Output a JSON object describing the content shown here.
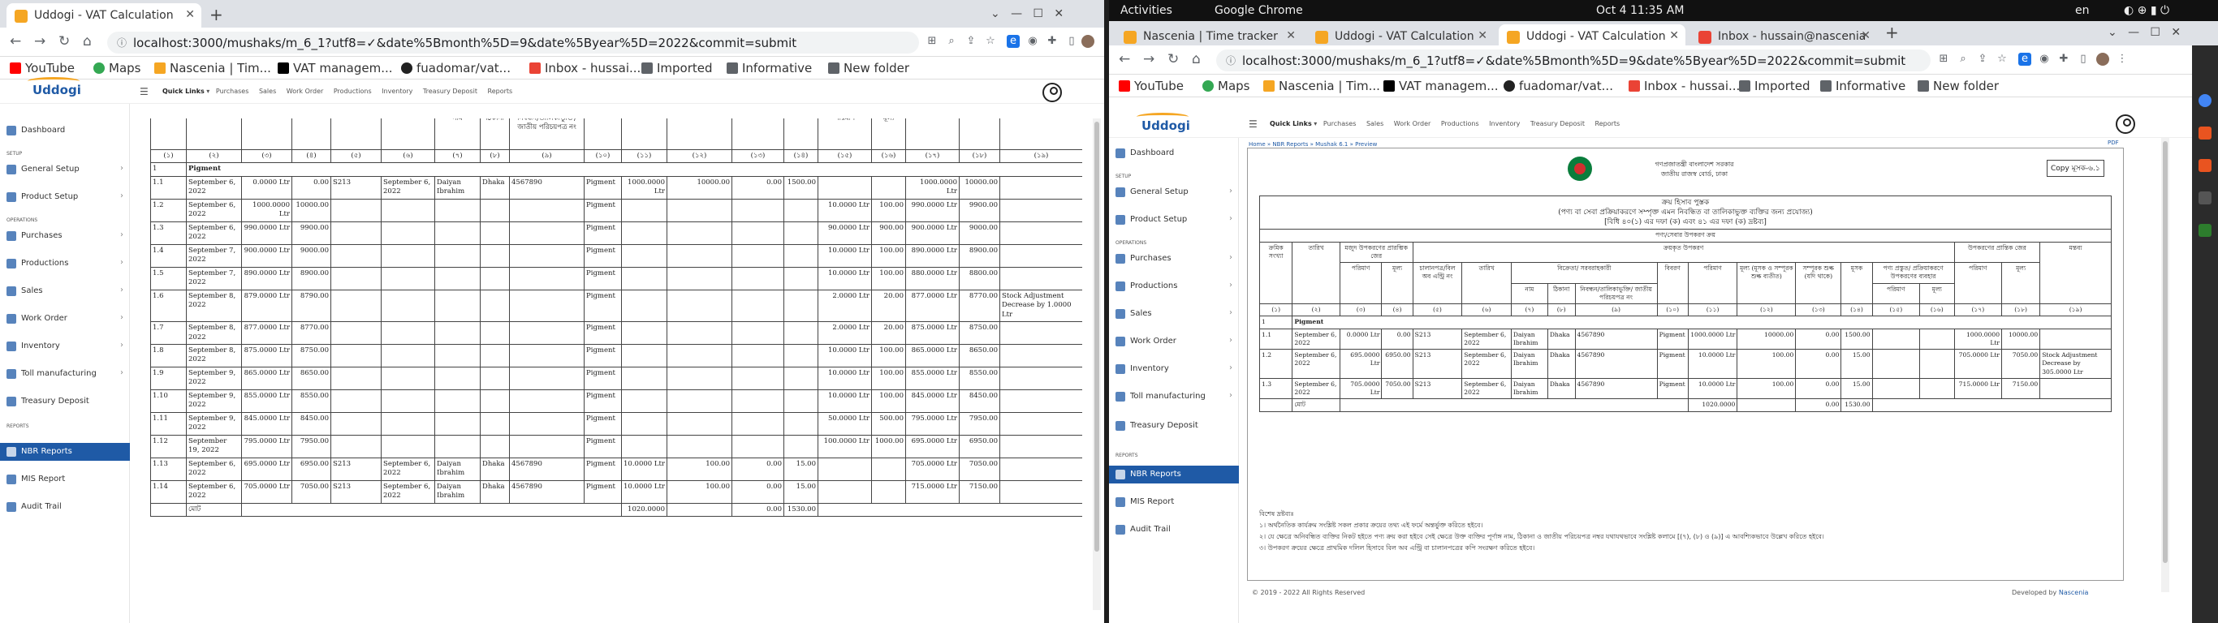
{
  "os": {
    "activities": "Activities",
    "app": "Google Chrome",
    "clock": "Oct 4  11:35 AM",
    "lang": "en"
  },
  "left": {
    "tabs": [
      {
        "label": "Uddogi - VAT Calculation"
      }
    ],
    "url": "localhost:3000/mushaks/m_6_1?utf8=✓&date%5Bmonth%5D=9&date%5Byear%5D=2022&commit=submit",
    "bookmarks": [
      "YouTube",
      "Maps",
      "Nascenia | Tim...",
      "VAT managem...",
      "fuadomar/vat...",
      "Inbox - hussai...",
      "Imported",
      "Informative",
      "New folder"
    ],
    "table_rows": [
      {
        "sl": "1.1",
        "date": "September 6, 2022",
        "o_qty": "0.0000 Ltr",
        "o_val": "0.00",
        "c_inv": "S213",
        "c_date": "September 6, 2022",
        "c_name": "Daiyan Ibrahim",
        "c_addr": "Dhaka",
        "c_bin": "4567890",
        "desc": "Pigment",
        "p_qty": "1000.0000 Ltr",
        "p_val": "10000.00",
        "sd": "0.00",
        "vat": "1500.00",
        "u_qty": "",
        "u_val": "",
        "cl_qty": "1000.0000 Ltr",
        "cl_val": "10000.00",
        "rem": ""
      },
      {
        "sl": "1.2",
        "date": "September 6, 2022",
        "o_qty": "1000.0000 Ltr",
        "o_val": "10000.00",
        "c_inv": "",
        "c_date": "",
        "c_name": "",
        "c_addr": "",
        "c_bin": "",
        "desc": "Pigment",
        "p_qty": "",
        "p_val": "",
        "sd": "",
        "vat": "",
        "u_qty": "10.0000 Ltr",
        "u_val": "100.00",
        "cl_qty": "990.0000 Ltr",
        "cl_val": "9900.00",
        "rem": ""
      },
      {
        "sl": "1.3",
        "date": "September 6, 2022",
        "o_qty": "990.0000 Ltr",
        "o_val": "9900.00",
        "c_inv": "",
        "c_date": "",
        "c_name": "",
        "c_addr": "",
        "c_bin": "",
        "desc": "Pigment",
        "p_qty": "",
        "p_val": "",
        "sd": "",
        "vat": "",
        "u_qty": "90.0000 Ltr",
        "u_val": "900.00",
        "cl_qty": "900.0000 Ltr",
        "cl_val": "9000.00",
        "rem": ""
      },
      {
        "sl": "1.4",
        "date": "September 7, 2022",
        "o_qty": "900.0000 Ltr",
        "o_val": "9000.00",
        "c_inv": "",
        "c_date": "",
        "c_name": "",
        "c_addr": "",
        "c_bin": "",
        "desc": "Pigment",
        "p_qty": "",
        "p_val": "",
        "sd": "",
        "vat": "",
        "u_qty": "10.0000 Ltr",
        "u_val": "100.00",
        "cl_qty": "890.0000 Ltr",
        "cl_val": "8900.00",
        "rem": ""
      },
      {
        "sl": "1.5",
        "date": "September 7, 2022",
        "o_qty": "890.0000 Ltr",
        "o_val": "8900.00",
        "c_inv": "",
        "c_date": "",
        "c_name": "",
        "c_addr": "",
        "c_bin": "",
        "desc": "Pigment",
        "p_qty": "",
        "p_val": "",
        "sd": "",
        "vat": "",
        "u_qty": "10.0000 Ltr",
        "u_val": "100.00",
        "cl_qty": "880.0000 Ltr",
        "cl_val": "8800.00",
        "rem": ""
      },
      {
        "sl": "1.6",
        "date": "September 8, 2022",
        "o_qty": "879.0000 Ltr",
        "o_val": "8790.00",
        "c_inv": "",
        "c_date": "",
        "c_name": "",
        "c_addr": "",
        "c_bin": "",
        "desc": "Pigment",
        "p_qty": "",
        "p_val": "",
        "sd": "",
        "vat": "",
        "u_qty": "2.0000 Ltr",
        "u_val": "20.00",
        "cl_qty": "877.0000 Ltr",
        "cl_val": "8770.00",
        "rem": "Stock Adjustment Decrease by 1.0000 Ltr"
      },
      {
        "sl": "1.7",
        "date": "September 8, 2022",
        "o_qty": "877.0000 Ltr",
        "o_val": "8770.00",
        "c_inv": "",
        "c_date": "",
        "c_name": "",
        "c_addr": "",
        "c_bin": "",
        "desc": "Pigment",
        "p_qty": "",
        "p_val": "",
        "sd": "",
        "vat": "",
        "u_qty": "2.0000 Ltr",
        "u_val": "20.00",
        "cl_qty": "875.0000 Ltr",
        "cl_val": "8750.00",
        "rem": ""
      },
      {
        "sl": "1.8",
        "date": "September 8, 2022",
        "o_qty": "875.0000 Ltr",
        "o_val": "8750.00",
        "c_inv": "",
        "c_date": "",
        "c_name": "",
        "c_addr": "",
        "c_bin": "",
        "desc": "Pigment",
        "p_qty": "",
        "p_val": "",
        "sd": "",
        "vat": "",
        "u_qty": "10.0000 Ltr",
        "u_val": "100.00",
        "cl_qty": "865.0000 Ltr",
        "cl_val": "8650.00",
        "rem": ""
      },
      {
        "sl": "1.9",
        "date": "September 9, 2022",
        "o_qty": "865.0000 Ltr",
        "o_val": "8650.00",
        "c_inv": "",
        "c_date": "",
        "c_name": "",
        "c_addr": "",
        "c_bin": "",
        "desc": "Pigment",
        "p_qty": "",
        "p_val": "",
        "sd": "",
        "vat": "",
        "u_qty": "10.0000 Ltr",
        "u_val": "100.00",
        "cl_qty": "855.0000 Ltr",
        "cl_val": "8550.00",
        "rem": ""
      },
      {
        "sl": "1.10",
        "date": "September 9, 2022",
        "o_qty": "855.0000 Ltr",
        "o_val": "8550.00",
        "c_inv": "",
        "c_date": "",
        "c_name": "",
        "c_addr": "",
        "c_bin": "",
        "desc": "Pigment",
        "p_qty": "",
        "p_val": "",
        "sd": "",
        "vat": "",
        "u_qty": "10.0000 Ltr",
        "u_val": "100.00",
        "cl_qty": "845.0000 Ltr",
        "cl_val": "8450.00",
        "rem": ""
      },
      {
        "sl": "1.11",
        "date": "September 9, 2022",
        "o_qty": "845.0000 Ltr",
        "o_val": "8450.00",
        "c_inv": "",
        "c_date": "",
        "c_name": "",
        "c_addr": "",
        "c_bin": "",
        "desc": "Pigment",
        "p_qty": "",
        "p_val": "",
        "sd": "",
        "vat": "",
        "u_qty": "50.0000 Ltr",
        "u_val": "500.00",
        "cl_qty": "795.0000 Ltr",
        "cl_val": "7950.00",
        "rem": ""
      },
      {
        "sl": "1.12",
        "date": "September 19, 2022",
        "o_qty": "795.0000 Ltr",
        "o_val": "7950.00",
        "c_inv": "",
        "c_date": "",
        "c_name": "",
        "c_addr": "",
        "c_bin": "",
        "desc": "Pigment",
        "p_qty": "",
        "p_val": "",
        "sd": "",
        "vat": "",
        "u_qty": "100.0000 Ltr",
        "u_val": "1000.00",
        "cl_qty": "695.0000 Ltr",
        "cl_val": "6950.00",
        "rem": ""
      },
      {
        "sl": "1.13",
        "date": "September 6, 2022",
        "o_qty": "695.0000 Ltr",
        "o_val": "6950.00",
        "c_inv": "S213",
        "c_date": "September 6, 2022",
        "c_name": "Daiyan Ibrahim",
        "c_addr": "Dhaka",
        "c_bin": "4567890",
        "desc": "Pigment",
        "p_qty": "10.0000 Ltr",
        "p_val": "100.00",
        "sd": "0.00",
        "vat": "15.00",
        "u_qty": "",
        "u_val": "",
        "cl_qty": "705.0000 Ltr",
        "cl_val": "7050.00",
        "rem": ""
      },
      {
        "sl": "1.14",
        "date": "September 6, 2022",
        "o_qty": "705.0000 Ltr",
        "o_val": "7050.00",
        "c_inv": "S213",
        "c_date": "September 6, 2022",
        "c_name": "Daiyan Ibrahim",
        "c_addr": "Dhaka",
        "c_bin": "4567890",
        "desc": "Pigment",
        "p_qty": "10.0000 Ltr",
        "p_val": "100.00",
        "sd": "0.00",
        "vat": "15.00",
        "u_qty": "",
        "u_val": "",
        "cl_qty": "715.0000 Ltr",
        "cl_val": "7150.00",
        "rem": ""
      }
    ],
    "total": {
      "label": "মোট",
      "p_qty": "1020.0000",
      "sd": "0.00",
      "vat": "1530.00"
    }
  },
  "right": {
    "tabs": [
      {
        "label": "Nascenia | Time tracker"
      },
      {
        "label": "Uddogi - VAT Calculation"
      },
      {
        "label": "Uddogi - VAT Calculation"
      },
      {
        "label": "Inbox - hussain@nascenia"
      }
    ],
    "url": "localhost:3000/mushaks/m_6_1?utf8=✓&date%5Bmonth%5D=9&date%5Byear%5D=2022&commit=submit",
    "breadcrumb": "Home » NBR Reports » Mushak 6.1 » Preview",
    "pdf_label": "PDF",
    "gov_line1": "গণপ্রজাতন্ত্রী বাংলাদেশ সরকার",
    "gov_line2": "জাতীয় রাজস্ব বোর্ড, ঢাকা",
    "copy_label": "Copy মূসক-৬.১",
    "title": "ক্রয় হিসাব পুস্তক",
    "subtitle1": "(পণ্য বা সেবা প্রক্রিয়াকরণে সম্পৃক্ত এমন নিবন্ধিত বা তালিকাভুক্ত ব্যক্তির জন্য প্রযোজ্য)",
    "subtitle2": "[বিধি ৪০(১) এর দফা (ক) এবং ৪১ এর দফা (ক) দ্রষ্টব্য]",
    "section": "পণ্য/সেবার উপকরণ ক্রয়",
    "rows": [
      {
        "sl": "1.1",
        "date": "September 6, 2022",
        "o_qty": "0.0000 Ltr",
        "o_val": "0.00",
        "c_inv": "S213",
        "c_date": "September 6, 2022",
        "c_name": "Daiyan Ibrahim",
        "c_addr": "Dhaka",
        "c_bin": "4567890",
        "desc": "Pigment",
        "p_qty": "1000.0000 Ltr",
        "p_val": "10000.00",
        "sd": "0.00",
        "vat": "1500.00",
        "u_qty": "",
        "u_val": "",
        "cl_qty": "1000.0000 Ltr",
        "cl_val": "10000.00",
        "rem": ""
      },
      {
        "sl": "1.2",
        "date": "September 6, 2022",
        "o_qty": "695.0000 Ltr",
        "o_val": "6950.00",
        "c_inv": "S213",
        "c_date": "September 6, 2022",
        "c_name": "Daiyan Ibrahim",
        "c_addr": "Dhaka",
        "c_bin": "4567890",
        "desc": "Pigment",
        "p_qty": "10.0000 Ltr",
        "p_val": "100.00",
        "sd": "0.00",
        "vat": "15.00",
        "u_qty": "",
        "u_val": "",
        "cl_qty": "705.0000 Ltr",
        "cl_val": "7050.00",
        "rem": "Stock Adjustment Decrease by 305.0000 Ltr"
      },
      {
        "sl": "1.3",
        "date": "September 6, 2022",
        "o_qty": "705.0000 Ltr",
        "o_val": "7050.00",
        "c_inv": "S213",
        "c_date": "September 6, 2022",
        "c_name": "Daiyan Ibrahim",
        "c_addr": "Dhaka",
        "c_bin": "4567890",
        "desc": "Pigment",
        "p_qty": "10.0000 Ltr",
        "p_val": "100.00",
        "sd": "0.00",
        "vat": "15.00",
        "u_qty": "",
        "u_val": "",
        "cl_qty": "715.0000 Ltr",
        "cl_val": "7150.00",
        "rem": ""
      }
    ],
    "total": {
      "label": "মোট",
      "p_qty": "1020.0000",
      "sd": "0.00",
      "vat": "1530.00"
    },
    "notes_title": "বিশেষ দ্রষ্টব্যঃ",
    "notes": [
      "১। অর্থনৈতিক কার্যক্রম সংশ্লিষ্ট সকল প্রকার ক্রয়ের তথ্য এই ফর্মে অন্তর্ভুক্ত করিতে হইবে।",
      "২। যে ক্ষেত্রে অনিবন্ধিত ব্যক্তির নিকট হইতে পণ্য ক্রয় করা হইবে সেই ক্ষেত্রে উক্ত ব্যক্তির পূর্ণাঙ্গ নাম, ঠিকানা ও জাতীয় পরিচয়পত্র নম্বর যথাযথভাবে সংশ্লিষ্ট কলামে [(৭), (৮) ও (৯)] এ আবশ্যিকভাবে উল্লেখ করিতে হইবে।",
      "৩। উপকরণ ক্রয়ের ক্ষেত্রে প্রাথমিক দলিল হিসাবে বিল অব এন্ট্রি বা চালানপত্রের কপি সংরক্ষণ করিতে হইবে।"
    ],
    "footer_left": "© 2019 - 2022 All Rights Reserved",
    "footer_right": "Developed by",
    "footer_brand": "Nascenia"
  },
  "headers": {
    "sl": "ক্রমিক সংখ্যা",
    "date": "তারিখ",
    "opening": "মজুদ উপকরণের প্রারম্ভিক জের",
    "qty": "পরিমাণ",
    "value": "মূল্য",
    "purchase": "ক্রয়কৃত উপকরণ",
    "invoice": "চালানপত্র/বিল অব এন্ট্রি নং",
    "seller": "বিক্রেতা/ সরবরাহকারী",
    "name": "নাম",
    "address": "ঠিকানা",
    "bin": "নিবন্ধন/তালিকাভুক্তি/ জাতীয় পরিচয়পত্র নং",
    "desc": "বিবরণ",
    "qty2": "পরিমাণ",
    "val_ex": "মূল্য (মূসক ও সম্পূরক শুল্ক ব্যতীত)",
    "sd": "সম্পূরক শুল্ক (যদি থাকে)",
    "vat": "মূসক",
    "usage": "পণ্য প্রস্তুত/ প্রক্রিয়াকরণে উপকরণের ব্যবহার",
    "closing": "উপকরণের প্রান্তিক জের",
    "remarks": "মন্তব্য",
    "nums": [
      "(১)",
      "(২)",
      "(৩)",
      "(৪)",
      "(৫)",
      "(৬)",
      "(৭)",
      "(৮)",
      "(৯)",
      "(১০)",
      "(১১)",
      "(১২)",
      "(১৩)",
      "(১৪)",
      "(১৫)",
      "(১৬)",
      "(১৭)",
      "(১৮)",
      "(১৯)"
    ],
    "group": "1",
    "group_label": "Pigment"
  },
  "app": {
    "logo": "Uddogi",
    "quick": "Quick Links",
    "qitems": [
      "Purchases",
      "Sales",
      "Work Order",
      "Productions",
      "Inventory",
      "Treasury Deposit",
      "Reports"
    ],
    "setup": "SETUP",
    "operations": "OPERATIONS",
    "reports": "REPORTS",
    "menu": {
      "dashboard": "Dashboard",
      "general": "General Setup",
      "product": "Product Setup",
      "purchases": "Purchases",
      "productions": "Productions",
      "sales": "Sales",
      "work": "Work Order",
      "inventory": "Inventory",
      "toll": "Toll manufacturing",
      "treasury": "Treasury Deposit",
      "nbr": "NBR Reports",
      "mis": "MIS Report",
      "audit": "Audit Trail"
    }
  },
  "colors": {
    "brand": "#1f5aa6",
    "accent": "#f5a623"
  }
}
